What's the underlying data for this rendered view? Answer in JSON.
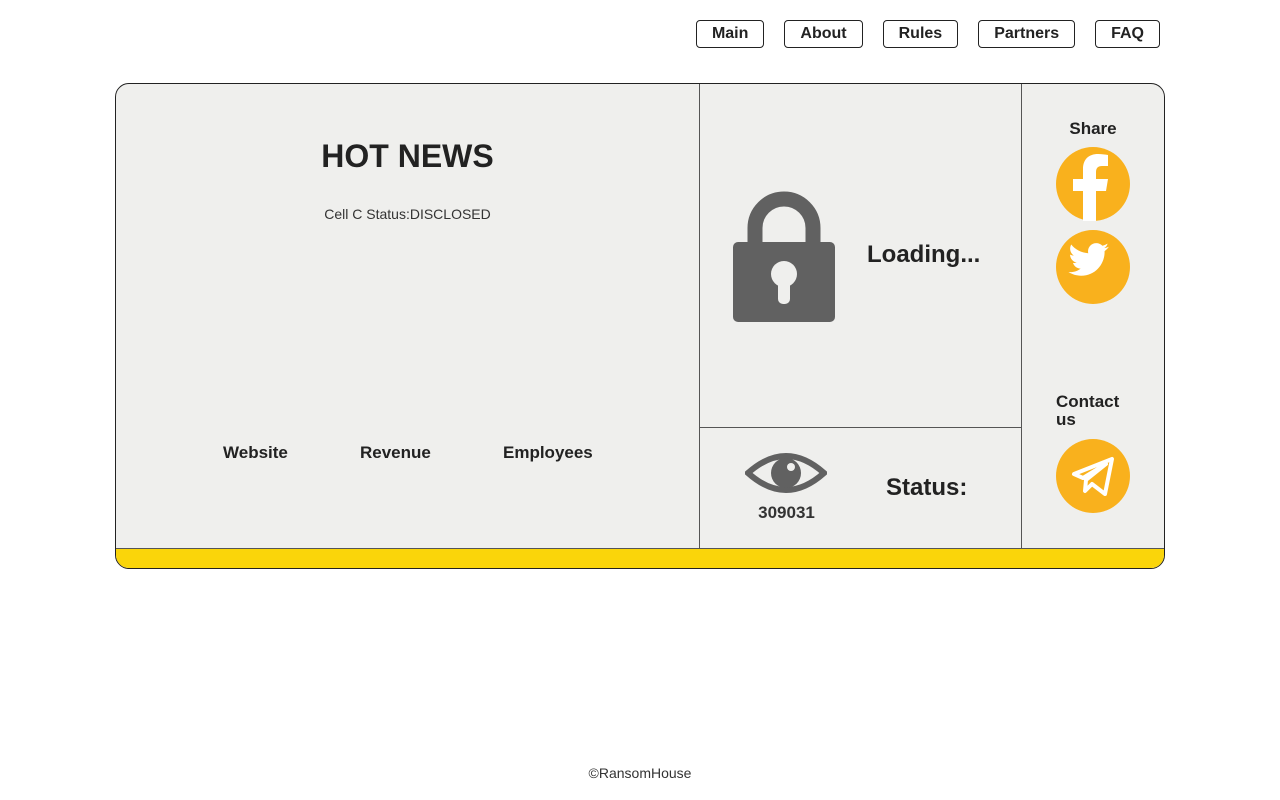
{
  "nav": {
    "items": [
      {
        "label": "Main"
      },
      {
        "label": "About"
      },
      {
        "label": "Rules"
      },
      {
        "label": "Partners"
      },
      {
        "label": "FAQ"
      }
    ]
  },
  "news": {
    "title": "HOT NEWS",
    "status_line": "Cell C Status:DISCLOSED",
    "fields": {
      "website": "Website",
      "revenue": "Revenue",
      "employees": "Employees"
    }
  },
  "lock_panel": {
    "icon": "lock-icon",
    "loading_text": "Loading..."
  },
  "views": {
    "icon": "eye-icon",
    "count": "309031",
    "status_label": "Status:"
  },
  "share": {
    "title": "Share",
    "facebook_icon": "facebook-icon",
    "twitter_icon": "twitter-icon"
  },
  "contact": {
    "title": "Contact us",
    "telegram_icon": "telegram-icon"
  },
  "colors": {
    "accent_yellow": "#fad50a",
    "social_orange": "#f9b11d",
    "panel_bg": "#efefed",
    "icon_gray": "#616161"
  },
  "footer": {
    "copyright": "©RansomHouse"
  }
}
